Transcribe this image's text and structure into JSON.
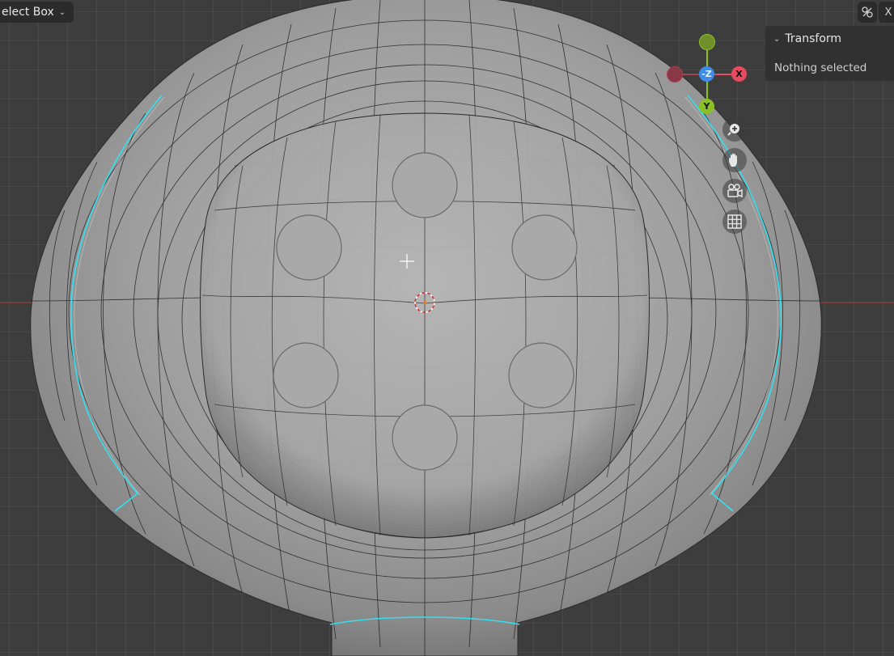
{
  "header": {
    "select_tool_label": "elect Box",
    "dropdown_icon": "chevron-down-icon"
  },
  "top_right": {
    "tools": [
      {
        "icon": "overlay-icon",
        "label": ""
      },
      {
        "icon": "close-icon",
        "label": "X"
      }
    ]
  },
  "sidebar_panel": {
    "title": "Transform",
    "body": "Nothing selected"
  },
  "gizmo": {
    "axes": [
      {
        "label": "-Z",
        "color": "#3d8ce8"
      },
      {
        "label": "X",
        "color": "#e84a5f"
      },
      {
        "label": "Y",
        "color": "#8cbf26"
      }
    ]
  },
  "nav_buttons": [
    {
      "name": "zoom-icon"
    },
    {
      "name": "pan-hand-icon"
    },
    {
      "name": "camera-icon"
    },
    {
      "name": "grid-icon"
    }
  ],
  "colors": {
    "viewport_bg": "#3d3d3d",
    "mesh_gray": "#a8a8a8",
    "seam_highlight": "#33e0f0",
    "x_axis_line": "#8a3a3a",
    "panel_bg": "#303030"
  }
}
